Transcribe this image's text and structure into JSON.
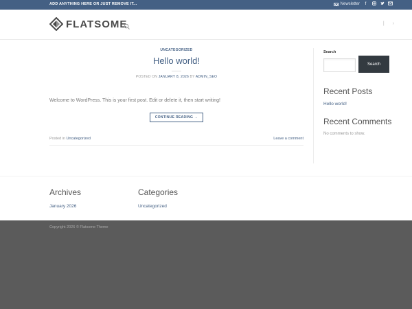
{
  "topbar": {
    "announcement": "ADD ANYTHING HERE OR JUST REMOVE IT...",
    "newsletter_label": "Newsletter",
    "social": [
      "facebook-icon",
      "instagram-icon",
      "twitter-icon",
      "email-icon"
    ]
  },
  "header": {
    "logo_text": "FLATSOME"
  },
  "post": {
    "category": "UNCATEGORIZED",
    "title": "Hello world!",
    "meta_prefix": "POSTED ON",
    "date": "JANUARY 8, 2026",
    "meta_by": "BY",
    "author": "ADMIN_SEO",
    "excerpt": "Welcome to WordPress. This is your first post. Edit or delete it, then start writing!",
    "read_more": "CONTINUE READING →",
    "posted_in_label": "Posted in",
    "posted_in_value": "Uncategorized",
    "leave_comment": "Leave a comment"
  },
  "sidebar": {
    "search_label": "Search",
    "search_button": "Search",
    "recent_posts_heading": "Recent Posts",
    "recent_posts": [
      "Hello world!"
    ],
    "recent_comments_heading": "Recent Comments",
    "recent_comments_empty": "No comments to show."
  },
  "footer": {
    "archives_heading": "Archives",
    "archives_item": "January 2026",
    "categories_heading": "Categories",
    "categories_item": "Uncategorized",
    "copyright": "Copyright 2026 © Flatsome Theme"
  },
  "colors": {
    "primary": "#446084",
    "topbar_bg": "#446084",
    "footer_bg": "#5b5b5b",
    "search_button_bg": "#333a40"
  }
}
